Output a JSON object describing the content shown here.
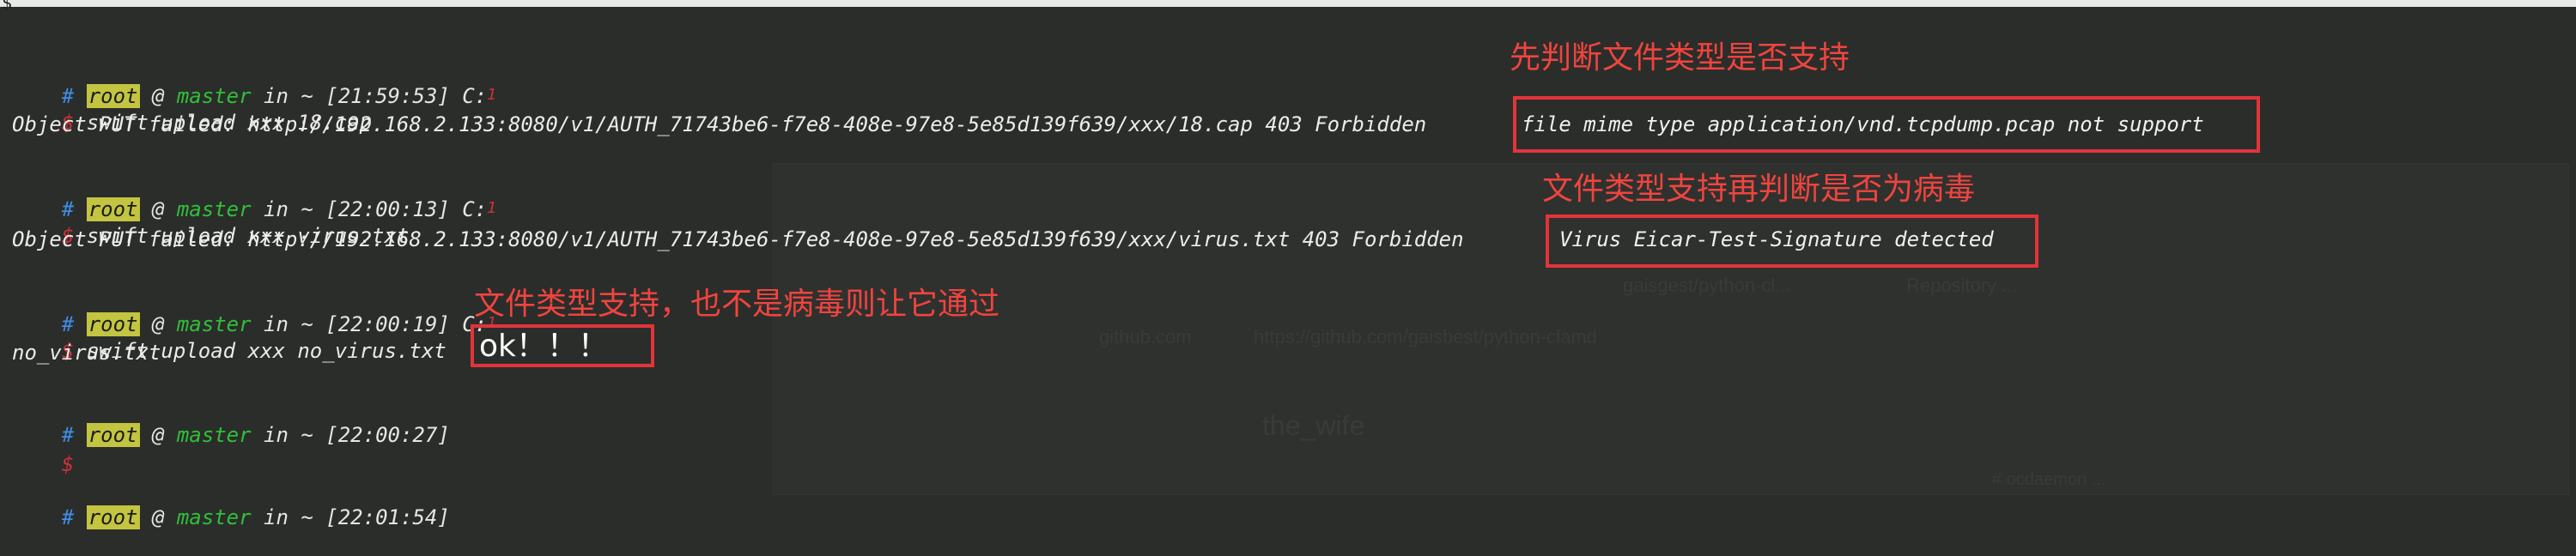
{
  "top_glyph": "$",
  "prompt": {
    "hash": "#",
    "user": "root",
    "at": "@",
    "host": "master",
    "in": "in",
    "dir": "~",
    "c_label": "C:",
    "c_value": "1",
    "dollar": "$"
  },
  "blocks": [
    {
      "time": "[21:59:53]",
      "command": "swift upload xxx 18.cap",
      "output": "Object PUT failed: http://192.168.2.133:8080/v1/AUTH_71743be6-f7e8-408e-97e8-5e85d139f639/xxx/18.cap 403 Forbidden"
    },
    {
      "time": "[22:00:13]",
      "command": "swift upload xxx virus.txt",
      "output": "Object PUT failed: http://192.168.2.133:8080/v1/AUTH_71743be6-f7e8-408e-97e8-5e85d139f639/xxx/virus.txt 403 Forbidden"
    },
    {
      "time": "[22:00:19]",
      "command": "swift upload xxx no_virus.txt",
      "output": "no_virus.txt"
    },
    {
      "time": "[22:00:27]",
      "command": "",
      "output": ""
    },
    {
      "time": "[22:01:54]"
    }
  ],
  "annotations": {
    "a1_title": "先判断文件类型是否支持",
    "a1_box": "file mime type application/vnd.tcpdump.pcap not support",
    "a2_title": "文件类型支持再判断是否为病毒",
    "a2_box": "Virus Eicar-Test-Signature detected",
    "a3_title": "文件类型支持，也不是病毒则让它通过",
    "a3_box": "ok！！！"
  },
  "background_ghost": {
    "b1": "github.com",
    "b2": "https://github.com/gaisbest/python-clamd",
    "b3": "the_wife",
    "b4": "# ocdaemon ...",
    "b5": "gaisgest/python-cl...",
    "b6": "Repository ..."
  },
  "colors": {
    "background": "#2b2d2a",
    "user_badge": "#c3c43f",
    "host": "#2fbf3a",
    "hash": "#3f8de6",
    "dollar": "#d03038",
    "annotation": "#e2343a"
  }
}
